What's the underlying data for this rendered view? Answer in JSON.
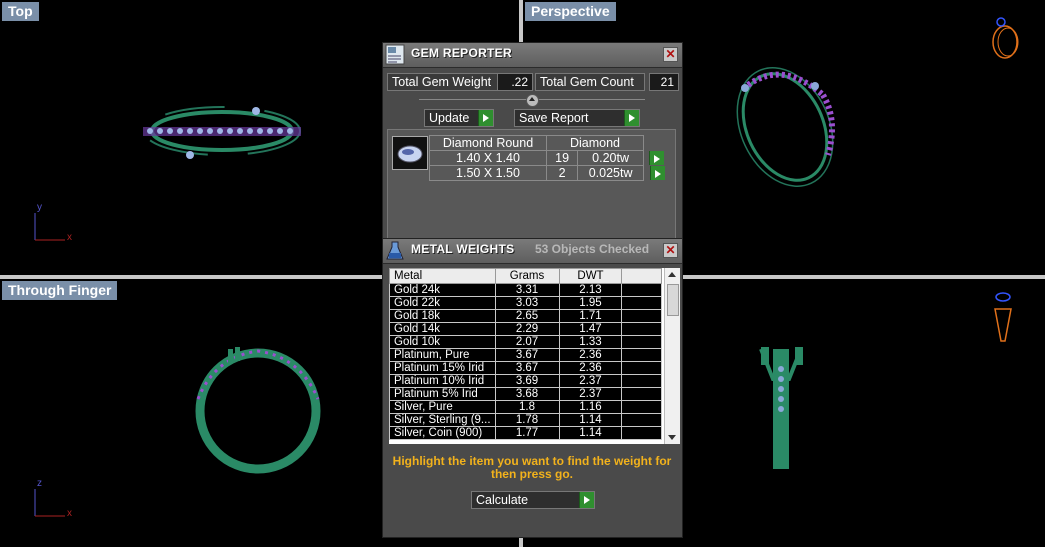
{
  "viewports": {
    "top": {
      "label": "Top",
      "axis_a": "y",
      "axis_b": "x"
    },
    "perspective": {
      "label": "Perspective"
    },
    "through_finger": {
      "label": "Through Finger",
      "axis_a": "z",
      "axis_b": "x"
    }
  },
  "gem_reporter": {
    "title": "GEM REPORTER",
    "close": "✕",
    "total_weight_label": "Total Gem Weight",
    "total_weight_value": ".22",
    "total_count_label": "Total Gem Count",
    "total_count_value": "21",
    "update_label": "Update",
    "save_report_label": "Save Report",
    "table": {
      "shape": "Diamond Round",
      "material": "Diamond",
      "rows": [
        {
          "size": "1.40 X 1.40",
          "count": "19",
          "tw": "0.20tw"
        },
        {
          "size": "1.50 X 1.50",
          "count": "2",
          "tw": "0.025tw"
        }
      ]
    }
  },
  "metal_weights": {
    "title": "METAL WEIGHTS",
    "status": "53 Objects Checked",
    "close": "✕",
    "headers": {
      "metal": "Metal",
      "grams": "Grams",
      "dwt": "DWT"
    },
    "rows": [
      {
        "metal": "Gold 24k",
        "grams": "3.31",
        "dwt": "2.13"
      },
      {
        "metal": "Gold 22k",
        "grams": "3.03",
        "dwt": "1.95"
      },
      {
        "metal": "Gold 18k",
        "grams": "2.65",
        "dwt": "1.71"
      },
      {
        "metal": "Gold 14k",
        "grams": "2.29",
        "dwt": "1.47"
      },
      {
        "metal": "Gold 10k",
        "grams": "2.07",
        "dwt": "1.33"
      },
      {
        "metal": "Platinum, Pure",
        "grams": "3.67",
        "dwt": "2.36"
      },
      {
        "metal": "Platinum 15% Irid",
        "grams": "3.67",
        "dwt": "2.36"
      },
      {
        "metal": "Platinum 10% Irid",
        "grams": "3.69",
        "dwt": "2.37"
      },
      {
        "metal": "Platinum 5% Irid",
        "grams": "3.68",
        "dwt": "2.37"
      },
      {
        "metal": "Silver, Pure",
        "grams": "1.8",
        "dwt": "1.16"
      },
      {
        "metal": "Silver, Sterling (9...",
        "grams": "1.78",
        "dwt": "1.14"
      },
      {
        "metal": "Silver, Coin (900)",
        "grams": "1.77",
        "dwt": "1.14"
      }
    ],
    "hint_line1": "Highlight the item you want to find the weight for",
    "hint_line2": "then press go.",
    "calculate_label": "Calculate"
  },
  "colors": {
    "ring": "#2a8a66",
    "gem": "#8aa8d8",
    "prong": "#9b4fd0",
    "accent_green": "#2f8f2f",
    "hint": "#f2b21c"
  }
}
